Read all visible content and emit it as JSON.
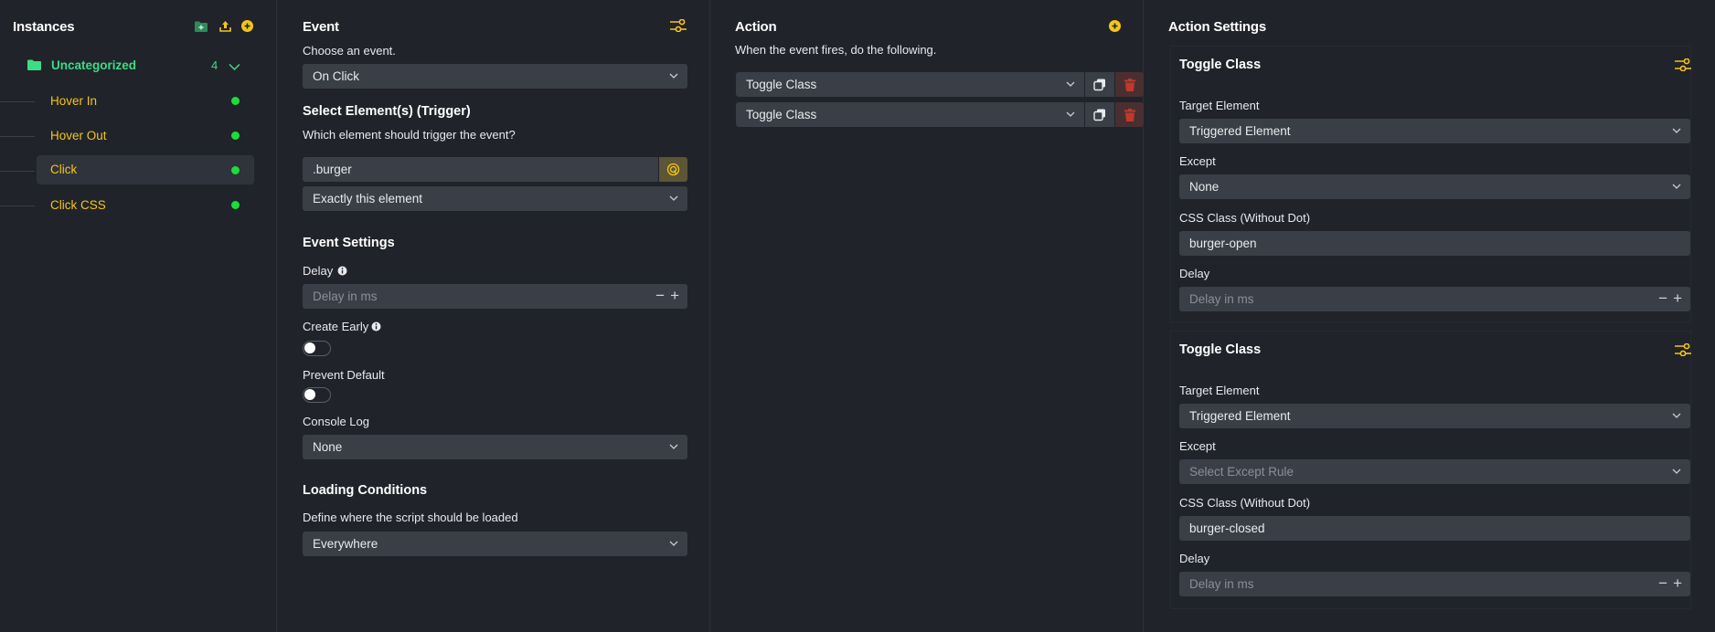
{
  "instances": {
    "title": "Instances",
    "folder": {
      "name": "Uncategorized",
      "count": "4"
    },
    "items": [
      {
        "label": "Hover In",
        "active": false
      },
      {
        "label": "Hover Out",
        "active": false
      },
      {
        "label": "Click",
        "active": true
      },
      {
        "label": "Click CSS",
        "active": false
      }
    ]
  },
  "event": {
    "title": "Event",
    "choose_label": "Choose an event.",
    "event_value": "On Click",
    "select_trigger_title": "Select Element(s) (Trigger)",
    "trigger_question": "Which element should trigger the event?",
    "selector_value": ".burger",
    "scope_value": "Exactly this element",
    "settings_title": "Event Settings",
    "delay_label": "Delay",
    "delay_placeholder": "Delay in ms",
    "create_early_label": "Create Early",
    "prevent_default_label": "Prevent Default",
    "console_log_label": "Console Log",
    "console_log_value": "None",
    "loading_title": "Loading Conditions",
    "loading_desc": "Define where the script should be loaded",
    "loading_value": "Everywhere"
  },
  "action": {
    "title": "Action",
    "desc": "When the event fires, do the following.",
    "rows": [
      {
        "value": "Toggle Class"
      },
      {
        "value": "Toggle Class"
      }
    ]
  },
  "settings": {
    "title": "Action Settings",
    "cards": [
      {
        "title": "Toggle Class",
        "target_label": "Target Element",
        "target_value": "Triggered Element",
        "except_label": "Except",
        "except_value": "None",
        "css_label": "CSS Class (Without Dot)",
        "css_value": "burger-open",
        "delay_label": "Delay",
        "delay_placeholder": "Delay in ms"
      },
      {
        "title": "Toggle Class",
        "target_label": "Target Element",
        "target_value": "Triggered Element",
        "except_label": "Except",
        "except_placeholder": "Select Except Rule",
        "css_label": "CSS Class (Without Dot)",
        "css_value": "burger-closed",
        "delay_label": "Delay",
        "delay_placeholder": "Delay in ms"
      }
    ]
  },
  "colors": {
    "accent_yellow": "#f5c518",
    "accent_green": "#3ddc84",
    "status_green": "#1adf36",
    "delete_red": "#c0392b",
    "panel_bg": "#20232a",
    "field_bg": "#3a3e46"
  }
}
